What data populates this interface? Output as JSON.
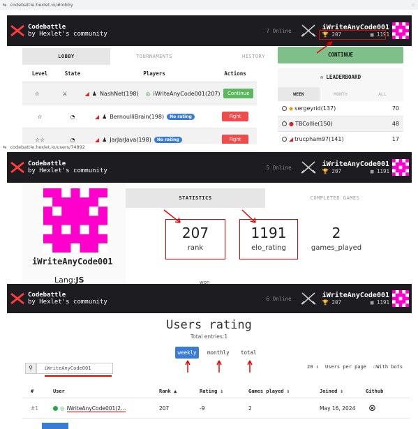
{
  "lobby_url": "codebattle.hexlet.io/#lobby",
  "user_url": "codebattle.hexlet.io/users/74892",
  "header": {
    "title": "Codebattle",
    "subtitle": "by Hexlet's community",
    "username": "iWriteAnyCode001",
    "rank": "207",
    "elo": "1191"
  },
  "lobby": {
    "online": "7 Online",
    "tabs": [
      "LOBBY",
      "TOURNAMENTS",
      "HISTORY"
    ],
    "continue_label": "CONTINUE",
    "columns": [
      "Level",
      "State",
      "Players",
      "Actions"
    ],
    "rows": [
      {
        "level": "☆",
        "p1": "NashNet(198)",
        "p2": "iWriteAnyCode001(207)",
        "action": "Continue"
      },
      {
        "level": "☆",
        "p1": "BernoulliBrain(198)",
        "badge": "No rating",
        "action": "Fight"
      },
      {
        "level": "☆☆",
        "p1": "JarJarJava(198)",
        "badge": "No rating",
        "action": "Fight"
      }
    ],
    "leaderboard": {
      "title": "LEADERBOARD",
      "tabs": [
        "WEEK",
        "MONTH",
        "ALL"
      ],
      "rows": [
        {
          "name": "sergeyrid(137)",
          "score": "70"
        },
        {
          "name": "TBCollie(150)",
          "score": "48"
        },
        {
          "name": "trucpham97(141)",
          "score": "17"
        }
      ]
    }
  },
  "profile": {
    "online": "5 Online",
    "tabs": [
      "STATISTICS",
      "COMPLETED GAMES"
    ],
    "name": "iWriteAnyCode001",
    "lang_label": "Lang:",
    "lang_value": "JS",
    "stats": [
      {
        "value": "207",
        "label": "rank"
      },
      {
        "value": "1191",
        "label": "elo_rating"
      },
      {
        "value": "2",
        "label": "games_played"
      }
    ],
    "won_label": "won"
  },
  "rating": {
    "online": "6 Online",
    "title": "Users rating",
    "entries": "Total entries:1",
    "periods": [
      "weekly",
      "monthly",
      "total"
    ],
    "search_value": "iWriteAnyCode001",
    "per_page_value": "20",
    "per_page_label": "Users per page",
    "bots_label": "With bots",
    "columns": [
      "#",
      "User",
      "Rank ▲",
      "Rating ⇕",
      "Games played ⇕",
      "Joined ⇕",
      "Github"
    ],
    "row": {
      "num": "#1",
      "user": "iWriteAnyCode001(2…",
      "rank": "207",
      "rating": "-9",
      "games": "2",
      "joined": "May 16, 2024"
    }
  },
  "colors": {
    "accent_red": "#e00000",
    "continue_green": "#7ebf8a",
    "fight_red": "#ef4b4b",
    "header_bg": "#1c1c21",
    "avatar_pink": "#ff00cc"
  }
}
